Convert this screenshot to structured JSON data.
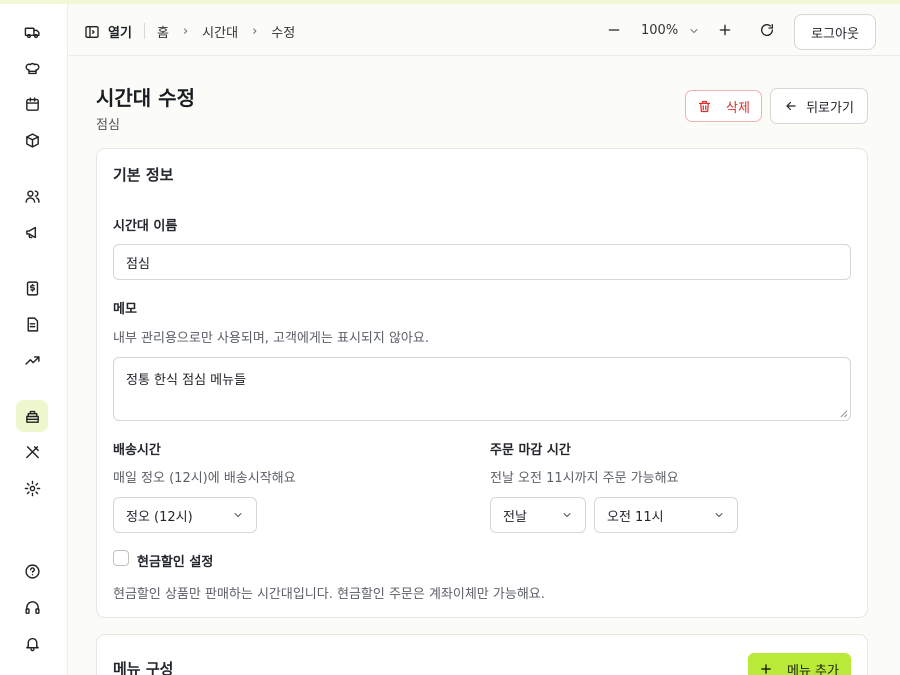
{
  "colors": {
    "accent": "#b9ea37",
    "danger": "#e03131",
    "active_nav_bg": "#eef8cf"
  },
  "sidebar": {
    "items": [
      {
        "icon": "truck-icon"
      },
      {
        "icon": "chef-hat-icon"
      },
      {
        "icon": "calendar-icon"
      },
      {
        "icon": "box-icon"
      },
      {
        "icon": "users-icon"
      },
      {
        "icon": "megaphone-icon"
      },
      {
        "icon": "dollar-receipt-icon"
      },
      {
        "icon": "document-icon"
      },
      {
        "icon": "trend-icon"
      },
      {
        "icon": "lunchbox-icon",
        "active": true
      },
      {
        "icon": "utensils-icon"
      },
      {
        "icon": "gear-icon"
      },
      {
        "icon": "help-icon"
      },
      {
        "icon": "headset-icon"
      },
      {
        "icon": "bell-icon"
      }
    ]
  },
  "topbar": {
    "toggle_label": "열기",
    "breadcrumb": [
      "홈",
      "시간대",
      "수정"
    ],
    "zoom": "100%",
    "logout_label": "로그아웃"
  },
  "header": {
    "title": "시간대 수정",
    "subtitle": "점심",
    "delete_label": "삭제",
    "back_label": "뒤로가기"
  },
  "basic_info": {
    "section_title": "기본 정보",
    "name_label": "시간대 이름",
    "name_value": "점심",
    "memo_label": "메모",
    "memo_help": "내부 관리용으로만 사용되며, 고객에게는 표시되지 않아요.",
    "memo_value": "정통 한식 점심 메뉴들",
    "delivery_label": "배송시간",
    "delivery_help": "매일 정오 (12시)에 배송시작해요",
    "delivery_value": "정오 (12시)",
    "cutoff_label": "주문 마감 시간",
    "cutoff_help": "전날 오전 11시까지 주문 가능해요",
    "cutoff_day_value": "전날",
    "cutoff_time_value": "오전 11시",
    "cash_label": "현금할인 설정",
    "cash_checked": false,
    "cash_help": "현금할인 상품만 판매하는 시간대입니다. 현금할인 주문은 계좌이체만 가능해요."
  },
  "menu_section": {
    "title": "메뉴 구성",
    "add_label": "메뉴 추가"
  }
}
